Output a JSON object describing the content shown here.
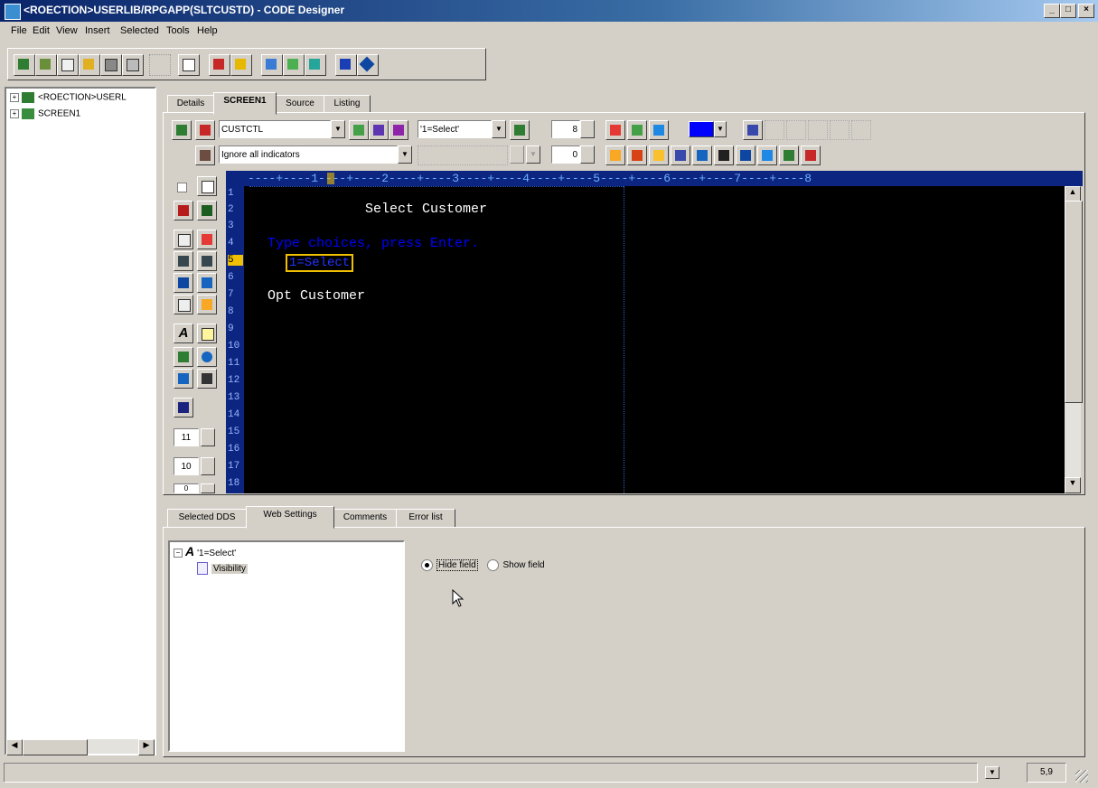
{
  "window": {
    "title": "<ROECTION>USERLIB/RPGAPP(SLTCUSTD) - CODE Designer",
    "controls": [
      "_",
      "□",
      "×"
    ]
  },
  "menu": [
    "File",
    "Edit",
    "View",
    "Insert",
    "Selected",
    "Tools",
    "Help"
  ],
  "tree": {
    "items": [
      {
        "label": "<ROECTION>USERL",
        "icon": "monitor-icon"
      },
      {
        "label": "SCREEN1",
        "icon": "screen-icon"
      }
    ]
  },
  "tabs": [
    "Details",
    "SCREEN1",
    "Source",
    "Listing"
  ],
  "active_tab": "SCREEN1",
  "editor_toolbar": {
    "record_format": "CUSTCTL",
    "field_select": "'1=Select'",
    "indicators": "Ignore all indicators",
    "spin1": "8",
    "spin2": "0",
    "color_accent": "#0000ff"
  },
  "left_tools": {
    "spin_a": "11",
    "spin_b": "10",
    "spin_c": "0"
  },
  "ruler_text": "----+----1----+----2----+----3----+----4----+----5----+----6----+----7----+----8",
  "screen": {
    "line_numbers": [
      "1",
      "2",
      "3",
      "4",
      "5",
      "6",
      "7",
      "8",
      "9",
      "10",
      "11",
      "12",
      "13",
      "14",
      "15",
      "16",
      "17",
      "18"
    ],
    "title": "Select Customer",
    "instruction": "Type choices, press Enter.",
    "selected_field": "1=Select",
    "header": "Opt Customer",
    "colors": {
      "background": "#000000",
      "text": "#ffffff",
      "instruction": "#0000ff",
      "selection": "#ffff00"
    }
  },
  "bottom_tabs": [
    "Selected DDS",
    "Web Settings",
    "Comments",
    "Error list"
  ],
  "active_bottom_tab": "Web Settings",
  "prop_tree": {
    "root": "'1=Select'",
    "child": "Visibility"
  },
  "visibility": {
    "options": [
      "Hide field",
      "Show field"
    ],
    "selected": "Hide field"
  },
  "status": {
    "position": "5,9"
  }
}
